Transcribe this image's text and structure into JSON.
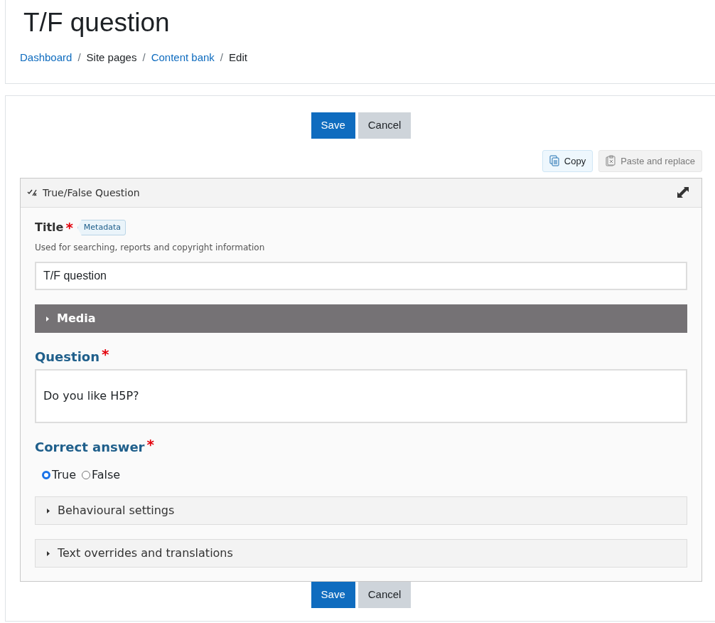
{
  "page_title": "T/F question",
  "breadcrumb_separator": "/",
  "breadcrumb": [
    {
      "label": "Dashboard",
      "link": true
    },
    {
      "label": "Site pages",
      "link": false
    },
    {
      "label": "Content bank",
      "link": true
    },
    {
      "label": "Edit",
      "link": false
    }
  ],
  "top_buttons": [
    {
      "label": "Save",
      "kind": "primary"
    },
    {
      "label": "Cancel",
      "kind": "secondary"
    }
  ],
  "clipboard": [
    {
      "label": "Copy",
      "disabled": false
    },
    {
      "label": "Paste and replace",
      "disabled": true
    }
  ],
  "editor": {
    "title": "True/False Question",
    "title_field": {
      "label": "Title",
      "required_mark": "*",
      "tag": "Metadata",
      "description": "Used for searching, reports and copyright information",
      "value": "T/F question"
    },
    "media": {
      "label": "Media",
      "expanded": false
    },
    "question": {
      "label": "Question",
      "required_mark": "*",
      "value": "Do you like H5P?"
    },
    "correct_answer": {
      "label": "Correct answer",
      "required_mark": "*",
      "options": [
        {
          "label": "True",
          "selected": true
        },
        {
          "label": "False",
          "selected": false
        }
      ]
    },
    "groups": [
      {
        "label": "Behavioural settings",
        "expanded": false
      },
      {
        "label": "Text overrides and translations",
        "expanded": false
      }
    ]
  },
  "bottom_buttons": [
    {
      "label": "Save",
      "kind": "primary"
    },
    {
      "label": "Cancel",
      "kind": "secondary"
    }
  ]
}
